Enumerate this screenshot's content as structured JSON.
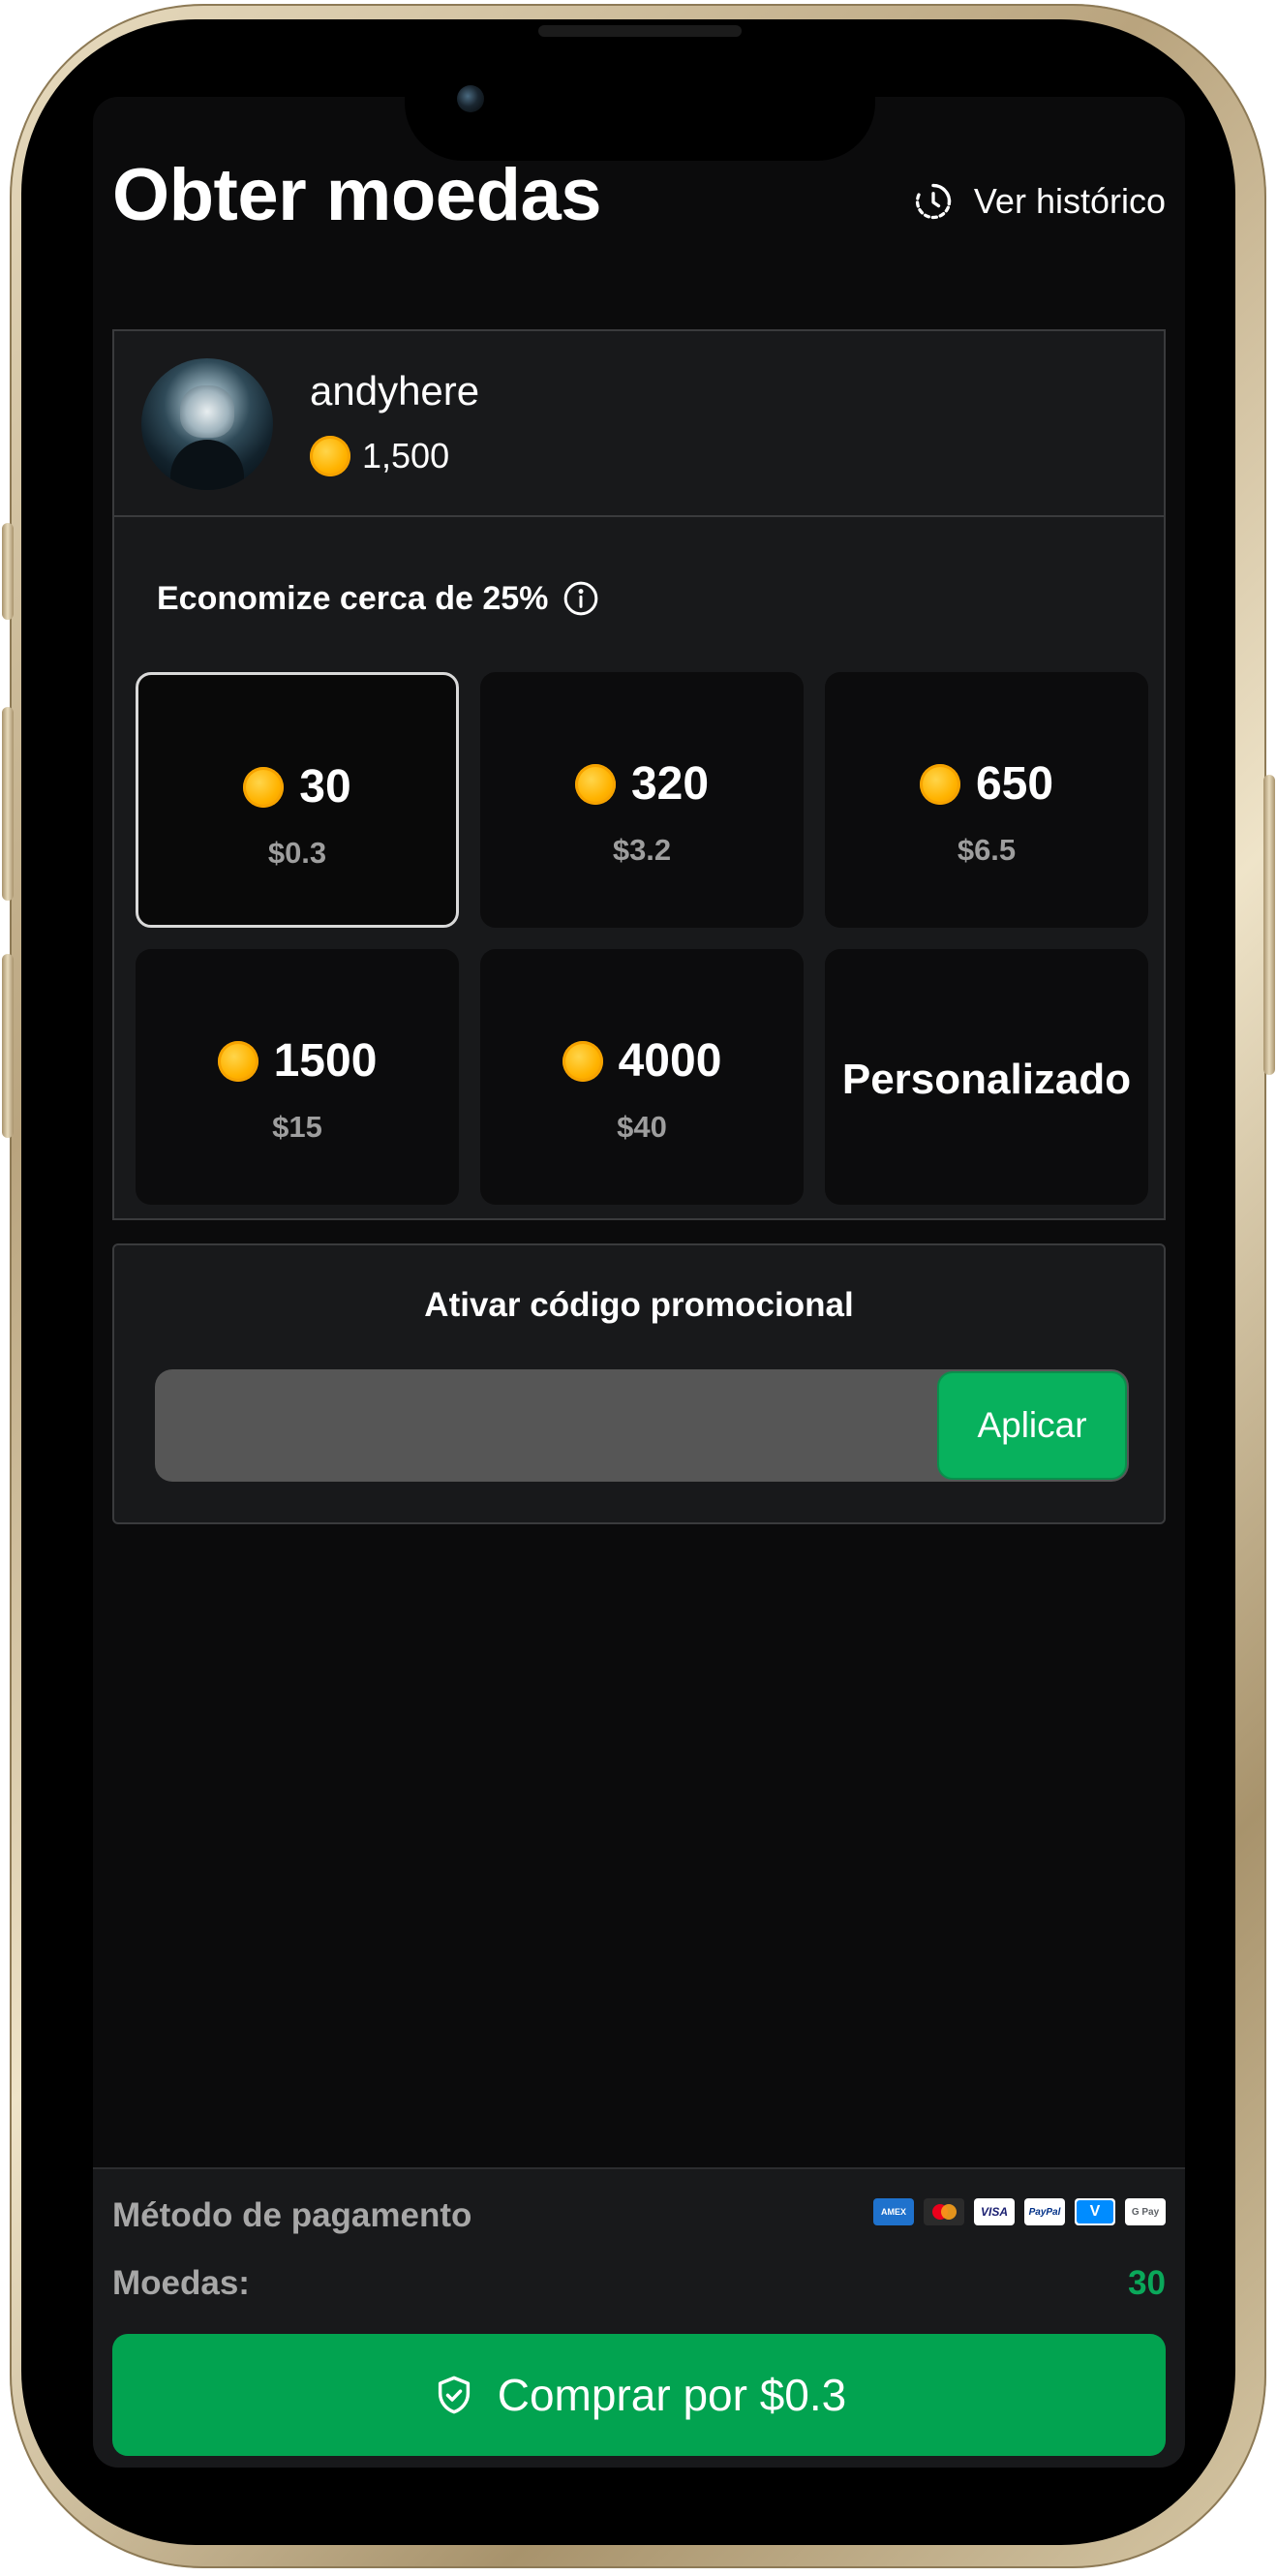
{
  "header": {
    "title": "Obter moedas",
    "history_label": "Ver histórico"
  },
  "user": {
    "name": "andyhere",
    "balance": "1,500"
  },
  "packages": {
    "savings_text": "Economize cerca de 25%",
    "items": [
      {
        "amount": "30",
        "price": "$0.3",
        "selected": true
      },
      {
        "amount": "320",
        "price": "$3.2"
      },
      {
        "amount": "650",
        "price": "$6.5"
      },
      {
        "amount": "1500",
        "price": "$15"
      },
      {
        "amount": "4000",
        "price": "$40"
      }
    ],
    "custom_label": "Personalizado"
  },
  "promo": {
    "title": "Ativar código promocional",
    "input_value": "",
    "apply_label": "Aplicar"
  },
  "payment": {
    "label": "Método de pagamento",
    "methods": [
      "amex",
      "mastercard",
      "visa",
      "paypal",
      "venmo",
      "google-pay"
    ],
    "coins_label": "Moedas:",
    "coins_value": "30",
    "buy_label": "Comprar por $0.3"
  },
  "colors": {
    "background": "#0b0b0c",
    "card": "#18191b",
    "accent_green": "#02a350",
    "coin_gold": "#ffb300"
  }
}
